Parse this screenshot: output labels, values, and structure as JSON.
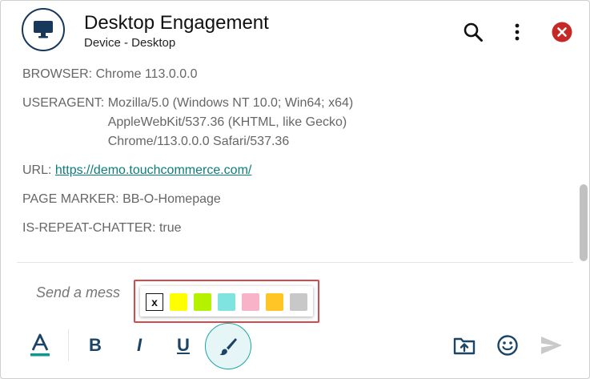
{
  "header": {
    "title": "Desktop Engagement",
    "subtitle": "Device - Desktop"
  },
  "details": {
    "browser_label": "BROWSER:",
    "browser_value": "Chrome 113.0.0.0",
    "useragent_label": "USERAGENT:",
    "useragent_lines": [
      "Mozilla/5.0 (Windows NT 10.0; Win64; x64)",
      "AppleWebKit/537.36 (KHTML, like Gecko)",
      "Chrome/113.0.0.0 Safari/537.36"
    ],
    "url_label": "URL:",
    "url_value": "https://demo.touchcommerce.com/",
    "page_marker_label": "PAGE MARKER:",
    "page_marker_value": "BB-O-Homepage",
    "repeat_label": "IS-REPEAT-CHATTER:",
    "repeat_value": "true"
  },
  "composer": {
    "placeholder_visible": "Send a mess"
  },
  "palette": {
    "clear_label": "x",
    "colors": [
      "#ffff00",
      "#b5f200",
      "#7fe3e0",
      "#f9b3c8",
      "#ffc425",
      "#c8c8c8"
    ]
  },
  "toolbar": {
    "bold_label": "B",
    "italic_label": "I",
    "underline_label": "U"
  },
  "colors": {
    "accent": "#0a7e7a",
    "navy": "#17385a",
    "close_red": "#c62828",
    "highlight_border": "#d64a4a"
  },
  "icons": {
    "avatar": "desktop-monitor-icon",
    "search": "search-icon",
    "menu": "more-vertical-icon",
    "close": "close-circle-icon",
    "font_color": "font-color-icon",
    "brush": "paint-brush-icon",
    "upload": "folder-upload-icon",
    "emoji": "emoji-icon",
    "send": "send-icon"
  }
}
